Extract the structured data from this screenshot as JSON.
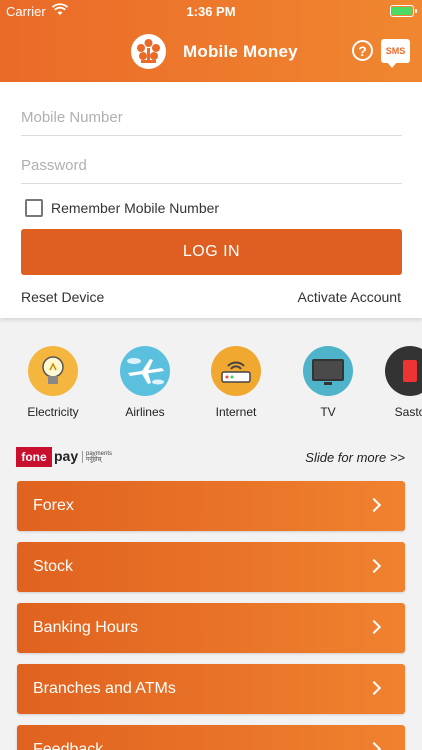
{
  "status_bar": {
    "carrier": "Carrier",
    "time": "1:36 PM"
  },
  "header": {
    "title": "Mobile Money",
    "help_icon": "?",
    "sms_icon": "SMS"
  },
  "login": {
    "mobile_placeholder": "Mobile Number",
    "password_placeholder": "Password",
    "remember_label": "Remember Mobile Number",
    "remember_checked": false,
    "login_button": "LOG IN",
    "reset_device": "Reset Device",
    "activate_account": "Activate Account"
  },
  "services": [
    {
      "label": "Electricity",
      "icon": "lightbulb-icon",
      "color": "#f4b63f"
    },
    {
      "label": "Airlines",
      "icon": "airplane-icon",
      "color": "#5bc0de"
    },
    {
      "label": "Internet",
      "icon": "router-icon",
      "color": "#f0a830"
    },
    {
      "label": "TV",
      "icon": "tv-icon",
      "color": "#4fb3c9"
    },
    {
      "label": "Sasto",
      "icon": "sasto-icon",
      "color": "#333333"
    }
  ],
  "fonepay": {
    "brand_left": "fone",
    "brand_right": "pay",
    "tagline": "payments गर्नुहोस्"
  },
  "slide_hint": "Slide for more >>",
  "menu": [
    {
      "label": "Forex"
    },
    {
      "label": "Stock"
    },
    {
      "label": "Banking Hours"
    },
    {
      "label": "Branches and ATMs"
    },
    {
      "label": "Feedback"
    }
  ],
  "colors": {
    "brand": "#ea6a28",
    "button": "#df5f22"
  }
}
